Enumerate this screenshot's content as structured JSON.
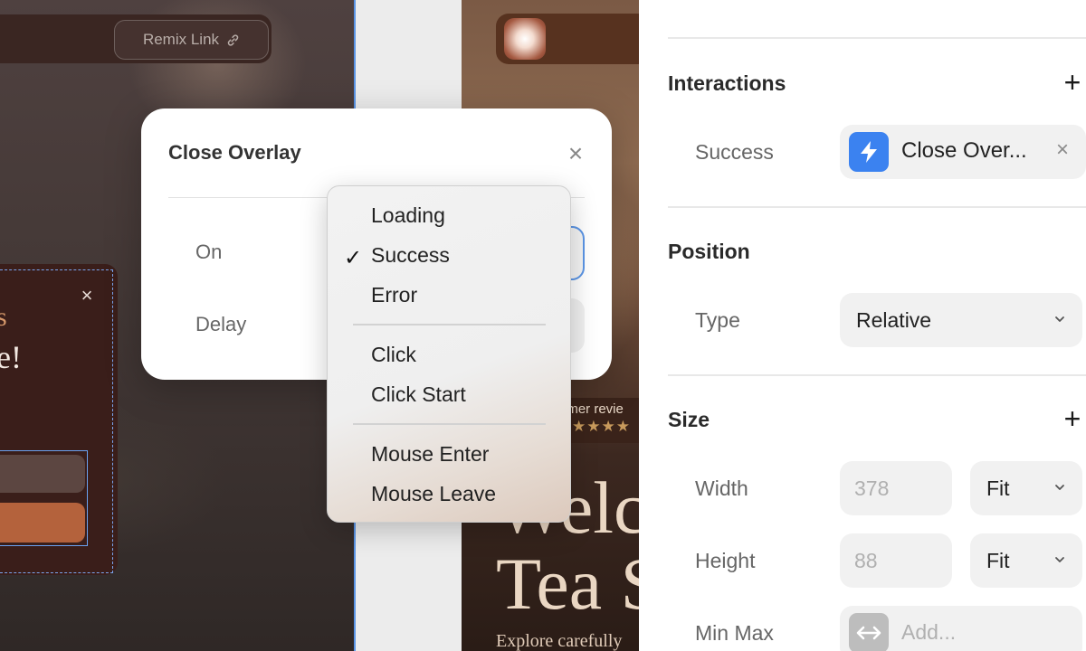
{
  "canvas": {
    "remix_link": {
      "label": "Remix Link",
      "icon": "link-icon"
    },
    "overlay": {
      "heading_fragment": "s",
      "text_fragment": "e!",
      "close_icon": "close-icon"
    },
    "hero": {
      "reviews_text": "omer revie",
      "stars": "★★★★",
      "title": "Welc\nTea S",
      "subtitle": "Explore carefully"
    }
  },
  "dialog": {
    "title": "Close Overlay",
    "on_label": "On",
    "delay_label": "Delay",
    "close_icon": "close-icon"
  },
  "dropdown": {
    "selected": "Success",
    "groups": [
      [
        "Loading",
        "Success",
        "Error"
      ],
      [
        "Click",
        "Click Start"
      ],
      [
        "Mouse Enter",
        "Mouse Leave"
      ]
    ],
    "items": {
      "loading": "Loading",
      "success": "Success",
      "error": "Error",
      "click": "Click",
      "click_start": "Click Start",
      "mouse_enter": "Mouse Enter",
      "mouse_leave": "Mouse Leave"
    },
    "check_icon": "✓"
  },
  "panel": {
    "interactions": {
      "title": "Interactions",
      "add_icon": "+",
      "trigger_label": "Success",
      "action_label": "Close Over...",
      "action_icon": "bolt-icon",
      "remove_icon": "×"
    },
    "position": {
      "title": "Position",
      "type_label": "Type",
      "type_value": "Relative"
    },
    "size": {
      "title": "Size",
      "add_icon": "+",
      "width_label": "Width",
      "width_value": "378",
      "width_mode": "Fit",
      "height_label": "Height",
      "height_value": "88",
      "height_mode": "Fit",
      "minmax_label": "Min Max",
      "minmax_placeholder": "Add..."
    }
  },
  "colors": {
    "accent": "#3b82f0",
    "selection": "#5b95e6",
    "button_orange": "#b4623c",
    "star_gold": "#c89a5c"
  }
}
